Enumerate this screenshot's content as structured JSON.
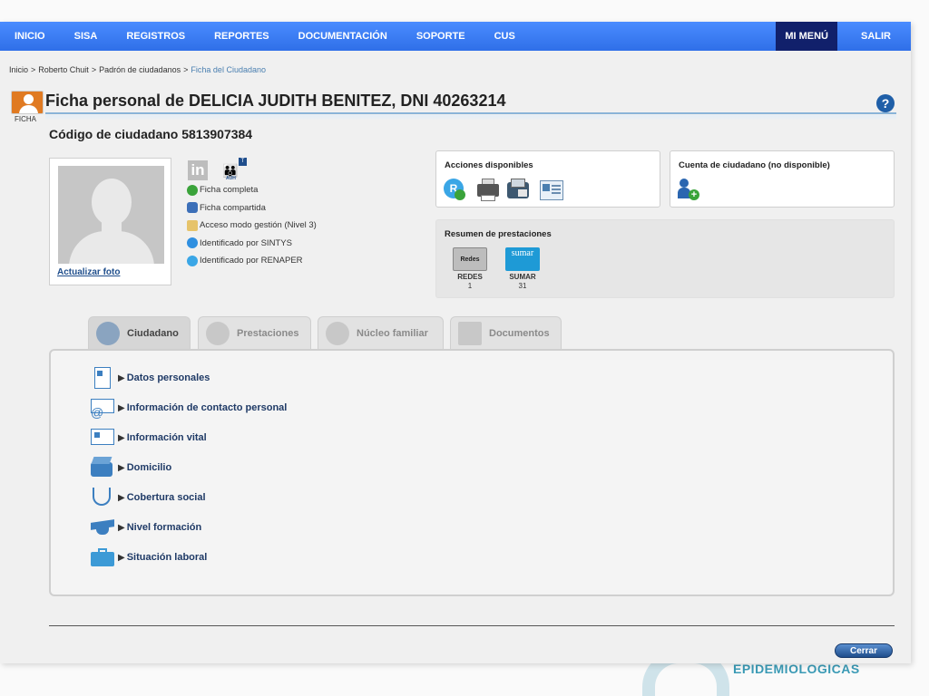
{
  "background": {
    "logo_word": "EPIDEMIOLOGICAS"
  },
  "nav": {
    "items": [
      "INICIO",
      "SISA",
      "REGISTROS",
      "REPORTES",
      "DOCUMENTACIÓN",
      "SOPORTE",
      "CUS"
    ],
    "my_menu": "MI MENÚ",
    "exit": "SALIR",
    "bar_color": "#3c82f6",
    "menu_color": "#11206b"
  },
  "breadcrumb": {
    "items": [
      "Inicio",
      "Roberto Chuit",
      "Padrón de ciudadanos",
      "Ficha del Ciudadano"
    ],
    "separator": ">"
  },
  "header": {
    "ficha_label": "FICHA",
    "title": "Ficha personal de DELICIA JUDITH BENITEZ, DNI 40263214",
    "help": "?",
    "citizen_code": "Código de ciudadano 5813907384"
  },
  "photo": {
    "update_link": "Actualizar foto"
  },
  "status_icons": {
    "in_letter": "in",
    "auh_letter": "T",
    "auh_label": "AUH"
  },
  "status": [
    {
      "icon": "check-icon",
      "text": "Ficha completa"
    },
    {
      "icon": "share-icon",
      "text": "Ficha compartida"
    },
    {
      "icon": "pencil-icon",
      "text": "Acceso modo gestión (Nivel 3)"
    },
    {
      "icon": "sintys-icon",
      "text": "Identificado por SINTYS"
    },
    {
      "icon": "renaper-icon",
      "text": "Identificado por RENAPER"
    }
  ],
  "acciones": {
    "title": "Acciones disponibles",
    "r_letter": "R"
  },
  "cuenta": {
    "title": "Cuenta de ciudadano (no disponible)",
    "plus": "+"
  },
  "resumen": {
    "title": "Resumen de prestaciones",
    "items": [
      {
        "tile": "Redes",
        "name": "REDES",
        "count": "1"
      },
      {
        "tile": "sumar",
        "name": "SUMAR",
        "count": "31"
      }
    ]
  },
  "tabs": [
    "Ciudadano",
    "Prestaciones",
    "Núcleo familiar",
    "Documentos"
  ],
  "sections": [
    {
      "icon": "id-card-icon",
      "label": "Datos personales"
    },
    {
      "icon": "email-icon",
      "label": "Información de contacto personal"
    },
    {
      "icon": "vital-record-icon",
      "label": "Información vital"
    },
    {
      "icon": "house-icon",
      "label": "Domicilio"
    },
    {
      "icon": "stethoscope-icon",
      "label": "Cobertura social"
    },
    {
      "icon": "graduation-cap-icon",
      "label": "Nivel formación"
    },
    {
      "icon": "briefcase-icon",
      "label": "Situación laboral"
    }
  ],
  "section_arrow": "▶",
  "footer": {
    "close": "Cerrar"
  }
}
